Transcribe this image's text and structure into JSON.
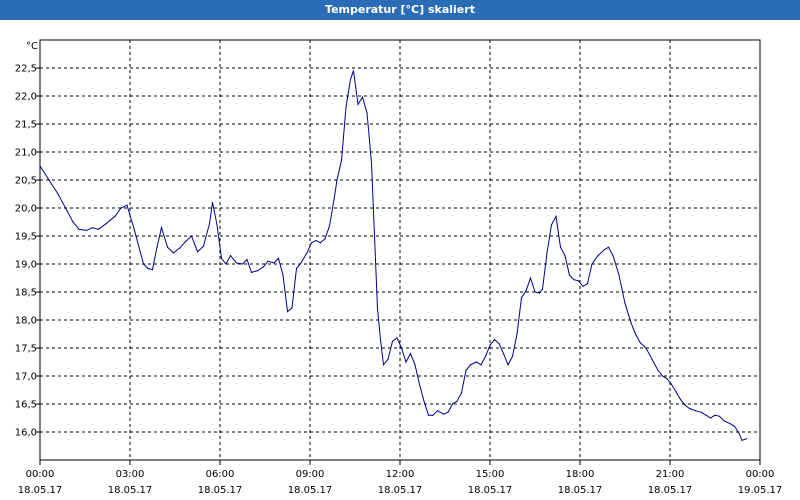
{
  "window": {
    "title": "Temperatur [°C] skaliert"
  },
  "chart_data": {
    "type": "line",
    "title": "Temperatur [°C] skaliert",
    "ylabel": "°C",
    "ylim": [
      15.5,
      23.0
    ],
    "xlim": [
      0,
      24
    ],
    "grid": true,
    "y_ticks": [
      "16,0",
      "16,5",
      "17,0",
      "17,5",
      "18,0",
      "18,5",
      "19,0",
      "19,5",
      "20,0",
      "20,5",
      "21,0",
      "21,5",
      "22,0",
      "22,5"
    ],
    "x_ticks": [
      {
        "time": "00:00",
        "date": "18.05.17"
      },
      {
        "time": "03:00",
        "date": "18.05.17"
      },
      {
        "time": "06:00",
        "date": "18.05.17"
      },
      {
        "time": "09:00",
        "date": "18.05.17"
      },
      {
        "time": "12:00",
        "date": "18.05.17"
      },
      {
        "time": "15:00",
        "date": "18.05.17"
      },
      {
        "time": "18:00",
        "date": "18.05.17"
      },
      {
        "time": "21:00",
        "date": "18.05.17"
      },
      {
        "time": "00:00",
        "date": "19.05.17"
      }
    ],
    "series": [
      {
        "color": "#00008b",
        "points": [
          [
            0.0,
            20.75
          ],
          [
            0.3,
            20.5
          ],
          [
            0.6,
            20.25
          ],
          [
            0.9,
            19.95
          ],
          [
            1.1,
            19.75
          ],
          [
            1.3,
            19.62
          ],
          [
            1.55,
            19.6
          ],
          [
            1.75,
            19.65
          ],
          [
            1.95,
            19.62
          ],
          [
            2.2,
            19.72
          ],
          [
            2.5,
            19.85
          ],
          [
            2.7,
            20.0
          ],
          [
            2.9,
            20.05
          ],
          [
            3.15,
            19.6
          ],
          [
            3.3,
            19.3
          ],
          [
            3.45,
            19.0
          ],
          [
            3.6,
            18.92
          ],
          [
            3.75,
            18.9
          ],
          [
            3.9,
            19.3
          ],
          [
            4.05,
            19.65
          ],
          [
            4.25,
            19.3
          ],
          [
            4.45,
            19.2
          ],
          [
            4.65,
            19.28
          ],
          [
            4.85,
            19.4
          ],
          [
            5.05,
            19.5
          ],
          [
            5.25,
            19.22
          ],
          [
            5.45,
            19.32
          ],
          [
            5.65,
            19.72
          ],
          [
            5.75,
            20.1
          ],
          [
            5.9,
            19.7
          ],
          [
            6.05,
            19.1
          ],
          [
            6.2,
            19.0
          ],
          [
            6.35,
            19.15
          ],
          [
            6.55,
            19.02
          ],
          [
            6.75,
            19.0
          ],
          [
            6.9,
            19.08
          ],
          [
            7.05,
            18.85
          ],
          [
            7.25,
            18.88
          ],
          [
            7.45,
            18.95
          ],
          [
            7.6,
            19.05
          ],
          [
            7.8,
            19.02
          ],
          [
            7.95,
            19.1
          ],
          [
            8.1,
            18.8
          ],
          [
            8.25,
            18.15
          ],
          [
            8.4,
            18.22
          ],
          [
            8.55,
            18.92
          ],
          [
            8.7,
            19.02
          ],
          [
            8.9,
            19.2
          ],
          [
            9.05,
            19.38
          ],
          [
            9.2,
            19.42
          ],
          [
            9.35,
            19.38
          ],
          [
            9.5,
            19.45
          ],
          [
            9.65,
            19.68
          ],
          [
            9.8,
            20.15
          ],
          [
            9.9,
            20.5
          ],
          [
            10.05,
            20.85
          ],
          [
            10.2,
            21.8
          ],
          [
            10.35,
            22.3
          ],
          [
            10.45,
            22.45
          ],
          [
            10.6,
            21.85
          ],
          [
            10.75,
            21.98
          ],
          [
            10.9,
            21.7
          ],
          [
            11.05,
            20.8
          ],
          [
            11.15,
            19.5
          ],
          [
            11.25,
            18.2
          ],
          [
            11.35,
            17.65
          ],
          [
            11.45,
            17.2
          ],
          [
            11.6,
            17.3
          ],
          [
            11.75,
            17.62
          ],
          [
            11.9,
            17.68
          ],
          [
            12.05,
            17.5
          ],
          [
            12.2,
            17.25
          ],
          [
            12.35,
            17.4
          ],
          [
            12.5,
            17.2
          ],
          [
            12.65,
            16.85
          ],
          [
            12.8,
            16.55
          ],
          [
            12.95,
            16.3
          ],
          [
            13.1,
            16.3
          ],
          [
            13.25,
            16.38
          ],
          [
            13.45,
            16.32
          ],
          [
            13.6,
            16.35
          ],
          [
            13.75,
            16.5
          ],
          [
            13.9,
            16.55
          ],
          [
            14.05,
            16.7
          ],
          [
            14.2,
            17.1
          ],
          [
            14.35,
            17.2
          ],
          [
            14.55,
            17.25
          ],
          [
            14.7,
            17.2
          ],
          [
            14.85,
            17.35
          ],
          [
            15.0,
            17.55
          ],
          [
            15.15,
            17.65
          ],
          [
            15.3,
            17.58
          ],
          [
            15.45,
            17.4
          ],
          [
            15.6,
            17.2
          ],
          [
            15.75,
            17.35
          ],
          [
            15.9,
            17.75
          ],
          [
            16.05,
            18.4
          ],
          [
            16.2,
            18.52
          ],
          [
            16.35,
            18.75
          ],
          [
            16.5,
            18.5
          ],
          [
            16.65,
            18.48
          ],
          [
            16.75,
            18.55
          ],
          [
            16.9,
            19.2
          ],
          [
            17.05,
            19.7
          ],
          [
            17.2,
            19.85
          ],
          [
            17.35,
            19.3
          ],
          [
            17.5,
            19.15
          ],
          [
            17.65,
            18.8
          ],
          [
            17.8,
            18.72
          ],
          [
            17.95,
            18.7
          ],
          [
            18.1,
            18.6
          ],
          [
            18.25,
            18.65
          ],
          [
            18.4,
            19.0
          ],
          [
            18.6,
            19.15
          ],
          [
            18.8,
            19.25
          ],
          [
            18.95,
            19.3
          ],
          [
            19.1,
            19.15
          ],
          [
            19.3,
            18.8
          ],
          [
            19.5,
            18.3
          ],
          [
            19.7,
            17.95
          ],
          [
            19.85,
            17.75
          ],
          [
            20.0,
            17.6
          ],
          [
            20.2,
            17.5
          ],
          [
            20.4,
            17.3
          ],
          [
            20.6,
            17.1
          ],
          [
            20.75,
            17.0
          ],
          [
            20.9,
            16.95
          ],
          [
            21.05,
            16.85
          ],
          [
            21.2,
            16.72
          ],
          [
            21.35,
            16.58
          ],
          [
            21.5,
            16.48
          ],
          [
            21.65,
            16.42
          ],
          [
            21.85,
            16.38
          ],
          [
            22.05,
            16.35
          ],
          [
            22.2,
            16.3
          ],
          [
            22.35,
            16.25
          ],
          [
            22.5,
            16.3
          ],
          [
            22.65,
            16.28
          ],
          [
            22.8,
            16.2
          ],
          [
            23.0,
            16.15
          ],
          [
            23.15,
            16.1
          ],
          [
            23.3,
            15.98
          ],
          [
            23.4,
            15.85
          ],
          [
            23.55,
            15.88
          ]
        ]
      }
    ]
  }
}
